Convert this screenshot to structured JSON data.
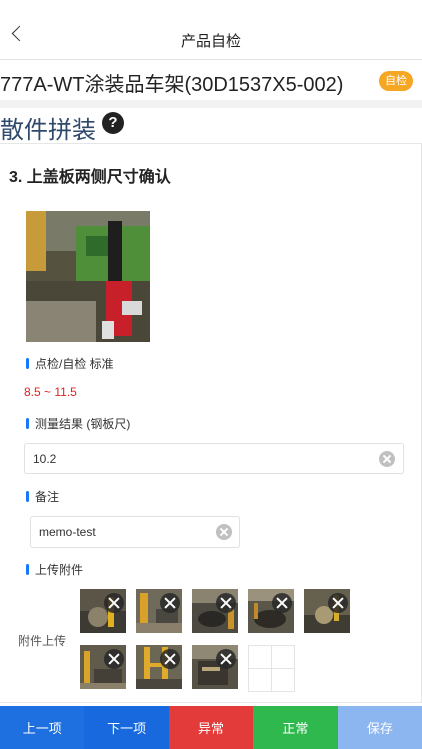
{
  "header": {
    "title": "产品自检"
  },
  "product": {
    "name": "777A-WT涂装品车架(30D1537X5-002)",
    "badge": "自检"
  },
  "section": {
    "title": "散件拼装",
    "help": "?"
  },
  "item": {
    "title": "3. 上盖板两侧尺寸确认",
    "standard_label": "点检/自检 标准",
    "standard_value": "8.5 ~ 11.5",
    "result_label": "测量结果 (钢板尺)",
    "result_value": "10.2",
    "remark_label": "备注",
    "remark_value": "memo-test",
    "attachments_label": "上传附件",
    "attach_upload_label": "附件上传"
  },
  "icons": {
    "back": "chevron-left-icon",
    "help": "question-circle-icon",
    "clear": "clear-circle-icon",
    "remove": "close-icon",
    "add": "plus-icon"
  },
  "actions": {
    "prev": "上一项",
    "next": "下一项",
    "abnormal": "异常",
    "normal": "正常",
    "save": "保存"
  },
  "colors": {
    "accent": "#1677ff",
    "badge": "#f5a623",
    "standard_text": "#e02020",
    "prev_bg": "#1e6fe0",
    "abnormal_bg": "#e33a3a",
    "normal_bg": "#2eb84d",
    "save_bg": "#8cb6ef"
  }
}
